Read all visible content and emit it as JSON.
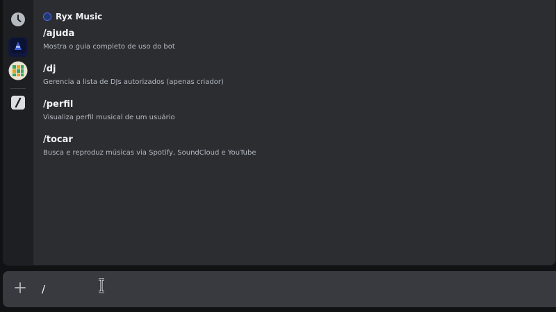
{
  "top_bleed_text": "",
  "rail": {
    "items": [
      {
        "icon": "clock-icon",
        "label": "Recentes"
      },
      {
        "icon": "bot-avatar-icon",
        "label": "Ryx Music"
      },
      {
        "icon": "grid-app-icon",
        "label": "App"
      },
      {
        "icon": "slash-command-icon",
        "label": "Comandos integrados"
      }
    ]
  },
  "app": {
    "name": "Ryx Music"
  },
  "commands": [
    {
      "name": "/ajuda",
      "description": "Mostra o guia completo de uso do bot"
    },
    {
      "name": "/dj",
      "description": "Gerencia a lista de DJs autorizados (apenas criador)"
    },
    {
      "name": "/perfil",
      "description": "Visualiza perfil musical de um usuário"
    },
    {
      "name": "/tocar",
      "description": "Busca e reproduz músicas via Spotify, SoundCloud e YouTube"
    }
  ],
  "composer": {
    "value": "/",
    "plus_icon": "plus-icon"
  },
  "colors": {
    "background": "#111214",
    "panel": "#2b2d31",
    "rail": "#1e1f22",
    "composer": "#383a40",
    "text_primary": "#f2f3f5",
    "text_secondary": "#b5bac1"
  }
}
